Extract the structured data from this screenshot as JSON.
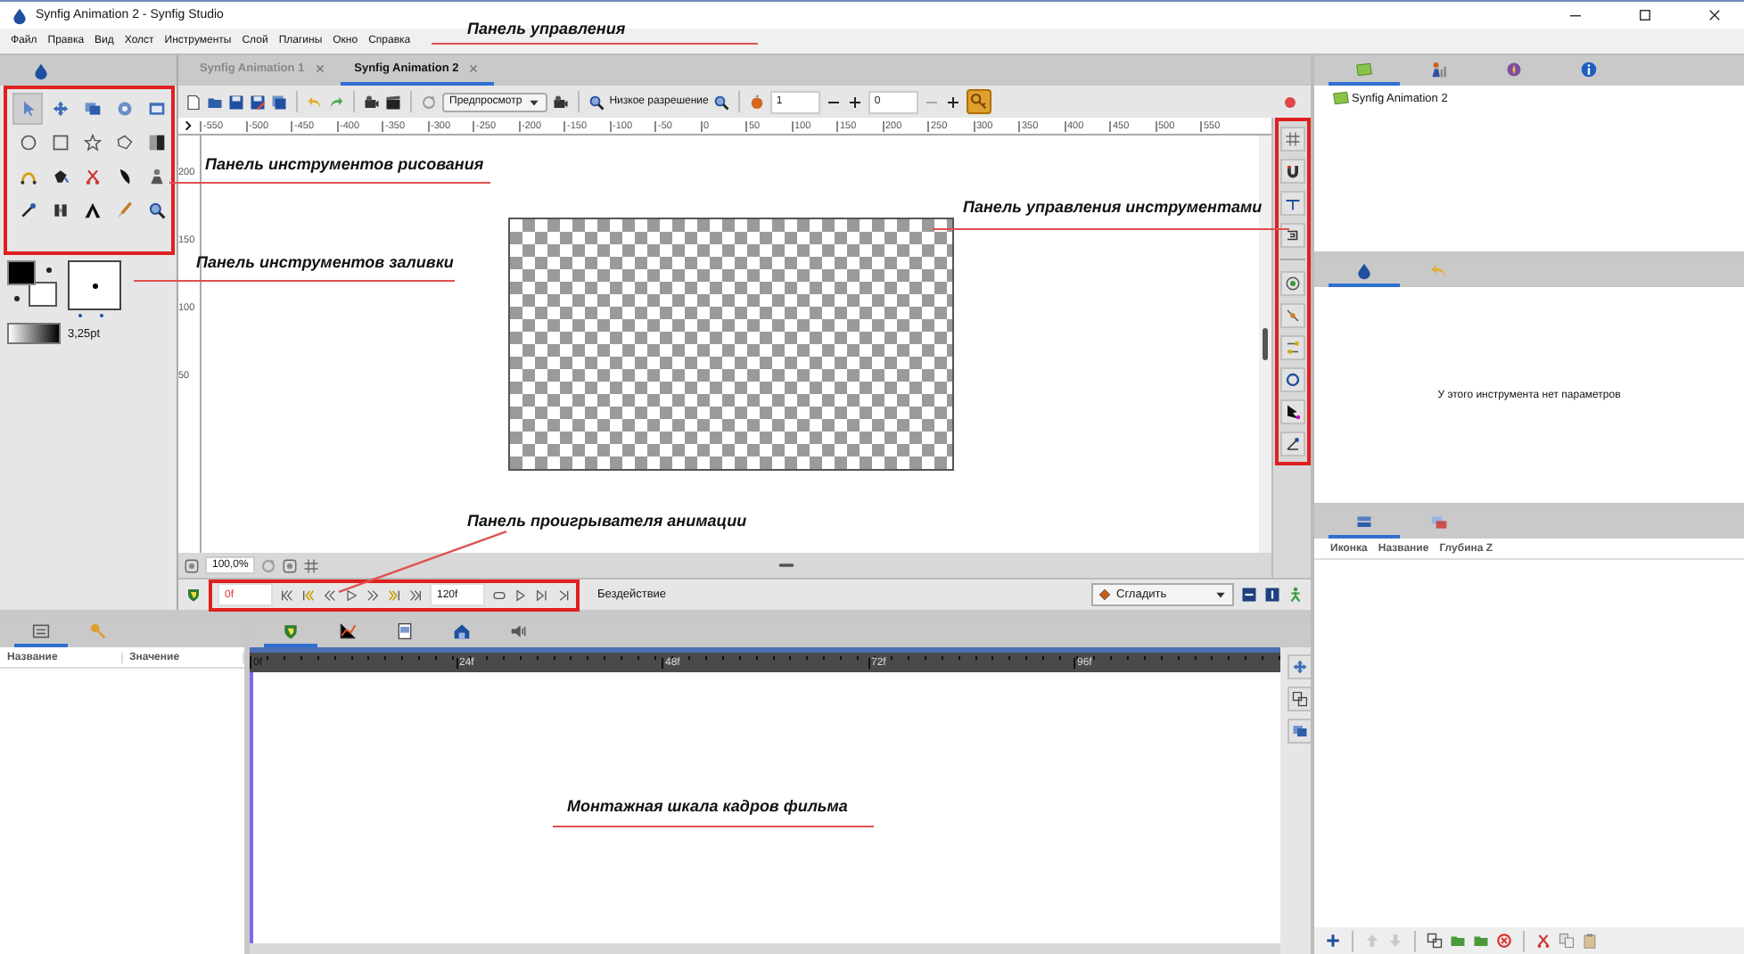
{
  "window": {
    "title": "Synfig Animation 2 - Synfig Studio"
  },
  "menu": [
    "Файл",
    "Правка",
    "Вид",
    "Холст",
    "Инструменты",
    "Слой",
    "Плагины",
    "Окно",
    "Справка"
  ],
  "toolbox": {
    "tools": [
      {
        "selected": true
      },
      {
        "selected": false
      },
      {
        "selected": false
      },
      {
        "selected": false
      },
      {
        "selected": false
      },
      {
        "selected": false
      },
      {
        "selected": false
      },
      {
        "selected": false
      },
      {
        "selected": false
      },
      {
        "selected": false
      },
      {
        "selected": false
      },
      {
        "selected": false
      },
      {
        "selected": false
      },
      {
        "selected": false
      },
      {
        "selected": false
      },
      {
        "selected": false
      },
      {
        "selected": false
      },
      {
        "selected": false
      },
      {
        "selected": false
      },
      {
        "selected": false
      }
    ],
    "brush_size": "3,25pt"
  },
  "document_tabs": [
    {
      "label": "Synfig Animation 1",
      "selected": false
    },
    {
      "label": "Synfig Animation 2",
      "selected": true
    }
  ],
  "toolbar": {
    "preview": "Предпросмотр",
    "resolution": "Низкое разрешение",
    "spin_1": "1",
    "spin_2": "0"
  },
  "ruler": {
    "horizontal": [
      "-550",
      "-500",
      "-450",
      "-400",
      "-350",
      "-300",
      "-250",
      "-200",
      "-150",
      "-100",
      "-50",
      "0",
      "50",
      "100",
      "150",
      "200",
      "250",
      "300",
      "350",
      "400",
      "450",
      "500",
      "550"
    ],
    "vertical": [
      "200",
      "150",
      "100",
      "50"
    ]
  },
  "canvas_footer": {
    "zoom": "100,0%"
  },
  "player": {
    "current_frame": "0f",
    "end_frame": "120f",
    "status": "Бездействие",
    "interpolation": "Сгладить"
  },
  "params": {
    "tabs": [
      {
        "selected": true
      },
      {
        "selected": false
      }
    ],
    "columns": [
      "Название",
      "Значение"
    ]
  },
  "timeline": {
    "tabs": [
      {
        "selected": true
      },
      {
        "selected": false
      },
      {
        "selected": false
      },
      {
        "selected": false
      },
      {
        "selected": false
      }
    ],
    "marks": [
      "0f",
      "24f",
      "48f",
      "72f",
      "96f"
    ]
  },
  "canvas_browser": {
    "tabs": [
      {
        "selected": true
      },
      {
        "selected": false
      },
      {
        "selected": false
      },
      {
        "selected": false
      }
    ],
    "items": [
      "Synfig Animation 2"
    ]
  },
  "tool_options": {
    "tabs": [
      {
        "selected": true
      },
      {
        "selected": false
      }
    ],
    "message": "У этого инструмента нет параметров"
  },
  "layers": {
    "tabs": [
      {
        "selected": true
      },
      {
        "selected": false
      }
    ],
    "columns": [
      "Иконка",
      "Название",
      "Глубина Z"
    ]
  },
  "annotations": [
    {
      "text": "Панель управления"
    },
    {
      "text": "Панель инструментов рисования"
    },
    {
      "text": "Панель инструментов заливки"
    },
    {
      "text": "Панель управления инструментами"
    },
    {
      "text": "Панель проигрывателя анимации"
    },
    {
      "text": "Монтажная шкала кадров фильма"
    }
  ]
}
